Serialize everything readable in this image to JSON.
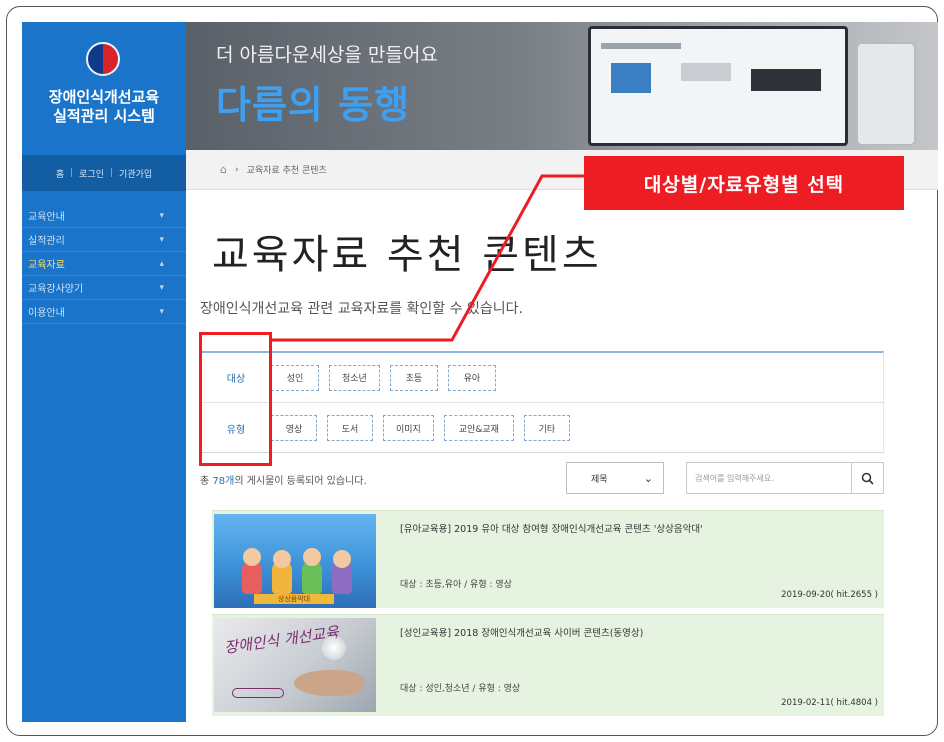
{
  "sidebar": {
    "title_line1": "장애인식개선교육",
    "title_line2": "실적관리 시스템",
    "login_links": [
      "홈",
      "로그인",
      "기관가입"
    ],
    "menu": [
      {
        "label": "교육안내",
        "active": false
      },
      {
        "label": "실적관리",
        "active": false
      },
      {
        "label": "교육자료",
        "active": true
      },
      {
        "label": "교육강사양기",
        "active": false
      },
      {
        "label": "이용안내",
        "active": false
      }
    ]
  },
  "banner": {
    "subtitle": "더 아름다운세상을 만들어요",
    "title": "다름의 동행"
  },
  "breadcrumb": {
    "current": "교육자료 추천 콘텐츠"
  },
  "callout": {
    "text": "대상별/자료유형별 선택"
  },
  "page": {
    "title": "교육자료 추천 콘텐츠",
    "description": "장애인식개선교육 관련 교육자료를 확인할 수 있습니다."
  },
  "filters": {
    "target": {
      "label": "대상",
      "options": [
        "성인",
        "청소년",
        "초등",
        "유아"
      ]
    },
    "type": {
      "label": "유형",
      "options": [
        "영상",
        "도서",
        "이미지",
        "교안&교재",
        "기타"
      ]
    }
  },
  "search": {
    "total_prefix": "총 ",
    "total_count": "78개",
    "total_suffix": "의 게시물이 등록되어 있습니다.",
    "select_value": "제목",
    "placeholder": "검색어를 입력해주세요."
  },
  "items": [
    {
      "title": "[유아교육용] 2019 유아 대상 참여형 장애인식개선교육 콘텐츠 '상상음악대'",
      "meta": "대상 : 초등,유아 / 유형 : 영상",
      "date": "2019-09-20( hit.2655 )",
      "thumb_text": "상상음악대"
    },
    {
      "title": "[성인교육용] 2018 장애인식개선교육 사이버 콘텐츠(동영상)",
      "meta": "대상 : 성인,청소년 / 유형 : 영상",
      "date": "2019-02-11( hit.4804 )",
      "thumb_text": "장애인식 개선교육"
    }
  ],
  "colors": {
    "sidebar": "#1a74c9",
    "accent_red": "#ee1c23",
    "list_bg": "#e6f3e0",
    "banner_title": "#3da0f2"
  }
}
